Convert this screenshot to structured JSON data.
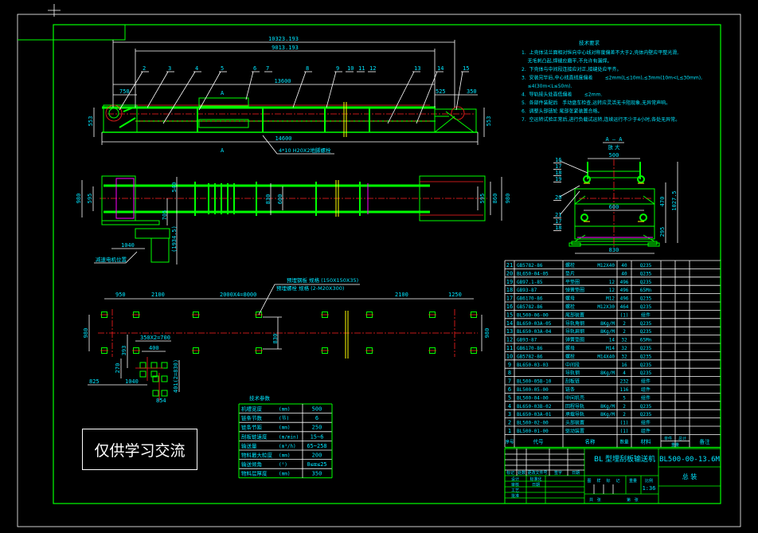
{
  "colors": {
    "background": "#000000",
    "frame": "#00ff00",
    "text": "#00e5ff",
    "centerline": "#ff2020",
    "dimension": "#ffffff"
  },
  "watermark": "仅供学习交流",
  "elevation": {
    "dims": {
      "overall": "10323.193",
      "inner": "9013.193",
      "span": "13600",
      "head": "750",
      "tail_a": "525",
      "tail_b": "350",
      "length": "14600",
      "height_left": "553",
      "height_right": "553"
    },
    "part_labels": [
      "2",
      "3",
      "4",
      "5",
      "6",
      "7",
      "8",
      "9",
      "10",
      "11",
      "12",
      "13",
      "14",
      "15"
    ],
    "section_mark": "A",
    "note": "4*10 H20X2地脚螺栓"
  },
  "plan": {
    "dims": {
      "w_left": "980",
      "inner_left": "595",
      "d540": "540",
      "d705": "705",
      "d1934": "(1934.5)",
      "d1040": "1040",
      "d830": "830",
      "d600": "600",
      "inner_right": "595",
      "d860": "860",
      "w_right": "980"
    },
    "label": "减速电机位置"
  },
  "foundation": {
    "dims": {
      "a": "950",
      "b": "2100",
      "c": "2000X4=8000",
      "d": "2100",
      "e": "1250",
      "left": "980",
      "right": "980",
      "mid": "830",
      "f": "350X2=700",
      "g": "400",
      "h": "393",
      "i": "270",
      "j": "401(2=830)",
      "k": "825",
      "l": "1040",
      "m": "854"
    },
    "note1": "预埋钢板 规格 (150X150X35)",
    "note2": "预埋螺栓 规格 (2-M20X300)"
  },
  "section": {
    "title": "A — A",
    "subtitle": "放 大",
    "dims": {
      "top": "500",
      "mid": "600",
      "bottom": "830",
      "h1": "470",
      "h2": "295",
      "total": "1027.5"
    },
    "labels": [
      "16",
      "17",
      "18",
      "19",
      "20",
      "21",
      "17",
      "18"
    ]
  },
  "notes": {
    "title": "技术要求",
    "lines": [
      "1.  上壳体法兰面相对纵向中心线对称度偏差不大于2,壳体内壁应平整光滑,",
      "    无毛刺凸起,焊缝应磨平,不允许有漏焊。",
      "2.  下壳体与中间段连接应对正,接缝处应平齐。",
      "3.  安装完毕后,中心线直线度偏差        ≤2mm(L≤10m),≤3mm(10m<L≤30mm),",
      "    ≤4(30m<L≤50m).",
      "4.  导轨接头处高低偏差        ≤2mm.",
      "5.  各部件装配后   手动盘车检查,运转应灵活无卡阻现象,无异常声响。",
      "6.  调整头部链轮 尾部张紧装置合格。",
      "7.  空运转试验正常后,进行负载试运转,连续运行不少于4小时,各处无异常。"
    ]
  },
  "specs": {
    "title": "技术参数",
    "rows": [
      {
        "label": "机槽宽度",
        "unit": "(mm)",
        "value": "500"
      },
      {
        "label": "链条节数",
        "unit": "(节)",
        "value": "6"
      },
      {
        "label": "链条节距",
        "unit": "(mm)",
        "value": "250"
      },
      {
        "label": "刮板链速度",
        "unit": "(m/min)",
        "value": "15~6"
      },
      {
        "label": "输送量",
        "unit": "(m³/h)",
        "value": "65~258"
      },
      {
        "label": "物料最大粒度",
        "unit": "(mm)",
        "value": "200"
      },
      {
        "label": "输送倾角",
        "unit": "(°)",
        "value": "0≤α≤25"
      },
      {
        "label": "物料层厚度",
        "unit": "(mm)",
        "value": "350"
      }
    ]
  },
  "parts": {
    "header": {
      "no": "序号",
      "code": "代号",
      "name": "名称",
      "qty": "数量",
      "material": "材料",
      "unit_w": "单件",
      "total_w": "总计",
      "weight": "重量",
      "remark": "备注"
    },
    "rows": [
      {
        "no": "21",
        "code": "GB5782-86",
        "name": "螺栓",
        "spec": "M12X40",
        "qty": "40",
        "material": "Q235"
      },
      {
        "no": "20",
        "code": "BL650-04-05",
        "name": "垫片",
        "spec": "",
        "qty": "40",
        "material": "Q235"
      },
      {
        "no": "19",
        "code": "GB97.1-85",
        "name": "平垫圈",
        "spec": "12",
        "qty": "496",
        "material": "Q235"
      },
      {
        "no": "18",
        "code": "GB93-87",
        "name": "弹簧垫圈",
        "spec": "12",
        "qty": "496",
        "material": "65Mn"
      },
      {
        "no": "17",
        "code": "GB6170-86",
        "name": "螺母",
        "spec": "M12",
        "qty": "496",
        "material": "Q235"
      },
      {
        "no": "16",
        "code": "GB5782-86",
        "name": "螺栓",
        "spec": "M12X30",
        "qty": "464",
        "material": "Q235"
      },
      {
        "no": "15",
        "code": "BL500-06-00",
        "name": "尾部装置",
        "spec": "",
        "qty": "(1)",
        "material": "组件"
      },
      {
        "no": "14",
        "code": "BL650-03A-05",
        "name": "导轨角钢",
        "spec": "8Kg/M",
        "qty": "2",
        "material": "Q235"
      },
      {
        "no": "13",
        "code": "BL650-03A-04",
        "name": "导轨扁钢",
        "spec": "8Kg/M",
        "qty": "2",
        "material": "Q235"
      },
      {
        "no": "12",
        "code": "GB93-87",
        "name": "弹簧垫圈",
        "spec": "14",
        "qty": "32",
        "material": "65Mn"
      },
      {
        "no": "11",
        "code": "GB6170-86",
        "name": "螺母",
        "spec": "M14",
        "qty": "32",
        "material": "Q235"
      },
      {
        "no": "10",
        "code": "GB5782-86",
        "name": "螺栓",
        "spec": "M14X40",
        "qty": "32",
        "material": "Q235"
      },
      {
        "no": "9",
        "code": "BL650-03-03",
        "name": "中间段",
        "spec": "",
        "qty": "16",
        "material": "Q235"
      },
      {
        "no": "8",
        "code": "",
        "name": "导轨钢",
        "spec": "8Kg/M",
        "qty": "4",
        "material": "Q235"
      },
      {
        "no": "7",
        "code": "BL500-05B-10",
        "name": "刮板链",
        "spec": "",
        "qty": "232",
        "material": "组件"
      },
      {
        "no": "6",
        "code": "BL500-05-00",
        "name": "链条",
        "spec": "",
        "qty": "116",
        "material": "组件"
      },
      {
        "no": "5",
        "code": "BL500-04-00",
        "name": "中间机壳",
        "spec": "",
        "qty": "5",
        "material": "组件"
      },
      {
        "no": "4",
        "code": "BL650-03B-02",
        "name": "回程导轨",
        "spec": "8Kg/M",
        "qty": "2",
        "material": "Q235"
      },
      {
        "no": "3",
        "code": "BL650-03A-01",
        "name": "承载导轨",
        "spec": "8Kg/M",
        "qty": "2",
        "material": "Q235"
      },
      {
        "no": "2",
        "code": "BL500-02-00",
        "name": "头部装置",
        "spec": "",
        "qty": "(1)",
        "material": "组件"
      },
      {
        "no": "1",
        "code": "BL500-01-00",
        "name": "驱动装置",
        "spec": "",
        "qty": "(1)",
        "material": "组件"
      }
    ]
  },
  "title_block": {
    "product": "BL 型埋刮板输送机",
    "drawing_no": "BL500-00-13.6M",
    "drawing_type": "总 装",
    "scale": "1:36",
    "left_labels": [
      "标记",
      "处数",
      "更改文件号",
      "签字",
      "日期"
    ],
    "roles": [
      "设计",
      "审核",
      "工艺",
      "批准"
    ],
    "roles2": [
      "标准化",
      "日期"
    ],
    "stage_labels": [
      "图",
      "样",
      "标",
      "记",
      "重量",
      "比例"
    ],
    "sheet": "共   张",
    "sheet2": "第   张"
  }
}
